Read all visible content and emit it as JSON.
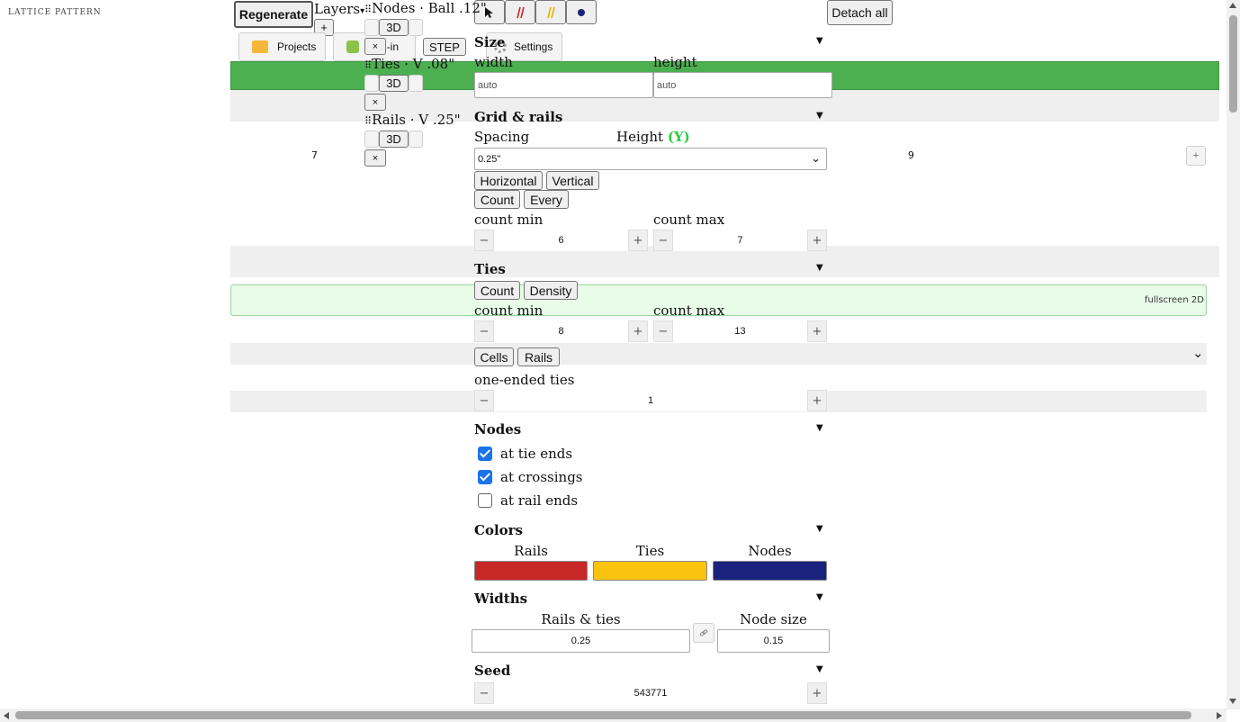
{
  "app": {
    "title": "LATTICE PATTERN"
  },
  "toolbar": {
    "regenerate": "Regenerate",
    "layers": "Layers",
    "layers_caret": "▾",
    "plus": "+",
    "projects": "Projects",
    "addin": "d-in",
    "step": "STEP",
    "settings": "Settings",
    "detach_all": "Detach all"
  },
  "layers": [
    {
      "name": "Nodes · Ball .12\"",
      "mode": "3D",
      "close": "×"
    },
    {
      "name": "Ties · V .08\"",
      "mode": "3D",
      "close": "×"
    },
    {
      "name": "Rails · V .25\"",
      "mode": "3D",
      "close": "×"
    }
  ],
  "canvas": {
    "left_value": "7",
    "right_value": "9",
    "right_plus": "+",
    "fullscreen": "fullscreen 2D",
    "dropdown_caret": "⌄"
  },
  "size": {
    "title": "Size",
    "width_label": "width",
    "height_label": "height",
    "width_placeholder": "auto",
    "height_placeholder": "auto"
  },
  "grid": {
    "title": "Grid & rails",
    "spacing_label": "Spacing",
    "height_label": "Height",
    "height_axis": "(Y)",
    "spacing_value": "0.25\"",
    "orientation": [
      "Horizontal",
      "Vertical"
    ],
    "mode": [
      "Count",
      "Every"
    ],
    "count_min_label": "count min",
    "count_max_label": "count max",
    "count_min": "6",
    "count_max": "7"
  },
  "ties": {
    "title": "Ties",
    "mode": [
      "Count",
      "Density"
    ],
    "count_min_label": "count min",
    "count_max_label": "count max",
    "count_min": "8",
    "count_max": "13",
    "target": [
      "Cells",
      "Rails"
    ],
    "one_ended_label": "one-ended ties",
    "one_ended": "1"
  },
  "nodes": {
    "title": "Nodes",
    "options": [
      {
        "label": "at tie ends",
        "checked": true
      },
      {
        "label": "at crossings",
        "checked": true
      },
      {
        "label": "at rail ends",
        "checked": false
      }
    ]
  },
  "colors": {
    "title": "Colors",
    "rails_label": "Rails",
    "ties_label": "Ties",
    "nodes_label": "Nodes",
    "rails": "#c62828",
    "ties": "#f9c30f",
    "nodes": "#1a237e"
  },
  "widths": {
    "title": "Widths",
    "rails_ties_label": "Rails & ties",
    "node_size_label": "Node size",
    "rails_ties": "0.25",
    "node_size": "0.15"
  },
  "seed": {
    "title": "Seed",
    "value": "543771"
  },
  "common": {
    "caret": "▼",
    "minus": "−",
    "plus": "+"
  }
}
